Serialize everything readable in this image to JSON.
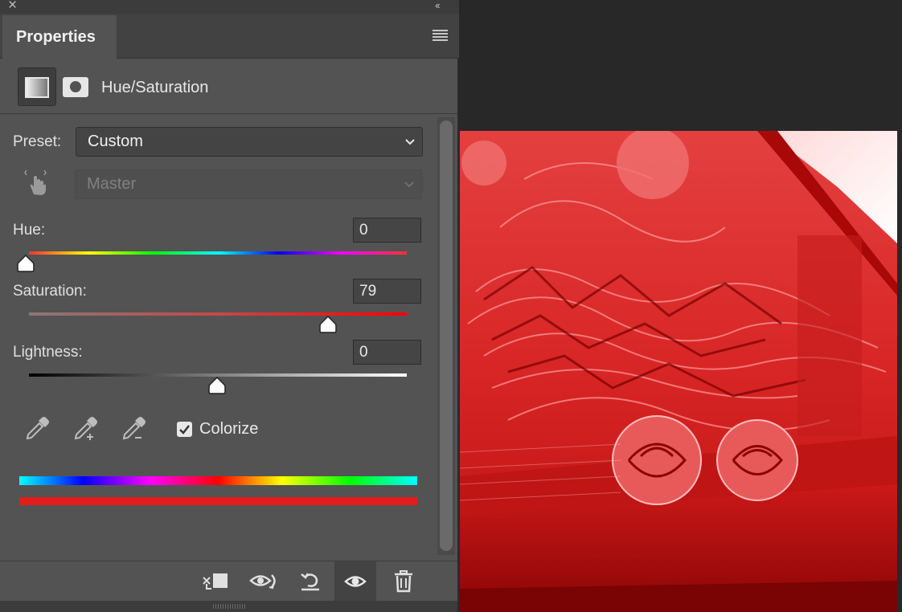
{
  "panel": {
    "tab_label": "Properties",
    "adjustment_title": "Hue/Saturation"
  },
  "preset": {
    "label": "Preset:",
    "value": "Custom"
  },
  "channel": {
    "value": "Master"
  },
  "hue": {
    "label": "Hue:",
    "value": "0",
    "range": [
      -180,
      180
    ]
  },
  "saturation": {
    "label": "Saturation:",
    "value": "79",
    "range": [
      0,
      100
    ]
  },
  "lightness": {
    "label": "Lightness:",
    "value": "0",
    "range": [
      -100,
      100
    ]
  },
  "colorize": {
    "label": "Colorize",
    "checked": true
  },
  "footer_buttons": [
    "clip-to-layer-icon",
    "view-previous-state-icon",
    "reset-icon",
    "visibility-eye-icon",
    "trash-icon"
  ],
  "colors": {
    "panel_bg": "#535353",
    "result_color": "#e31c1c",
    "canvas_bg": "#282828"
  },
  "canvas": {
    "image_description_icon": "red-tinted-mural-photo"
  }
}
